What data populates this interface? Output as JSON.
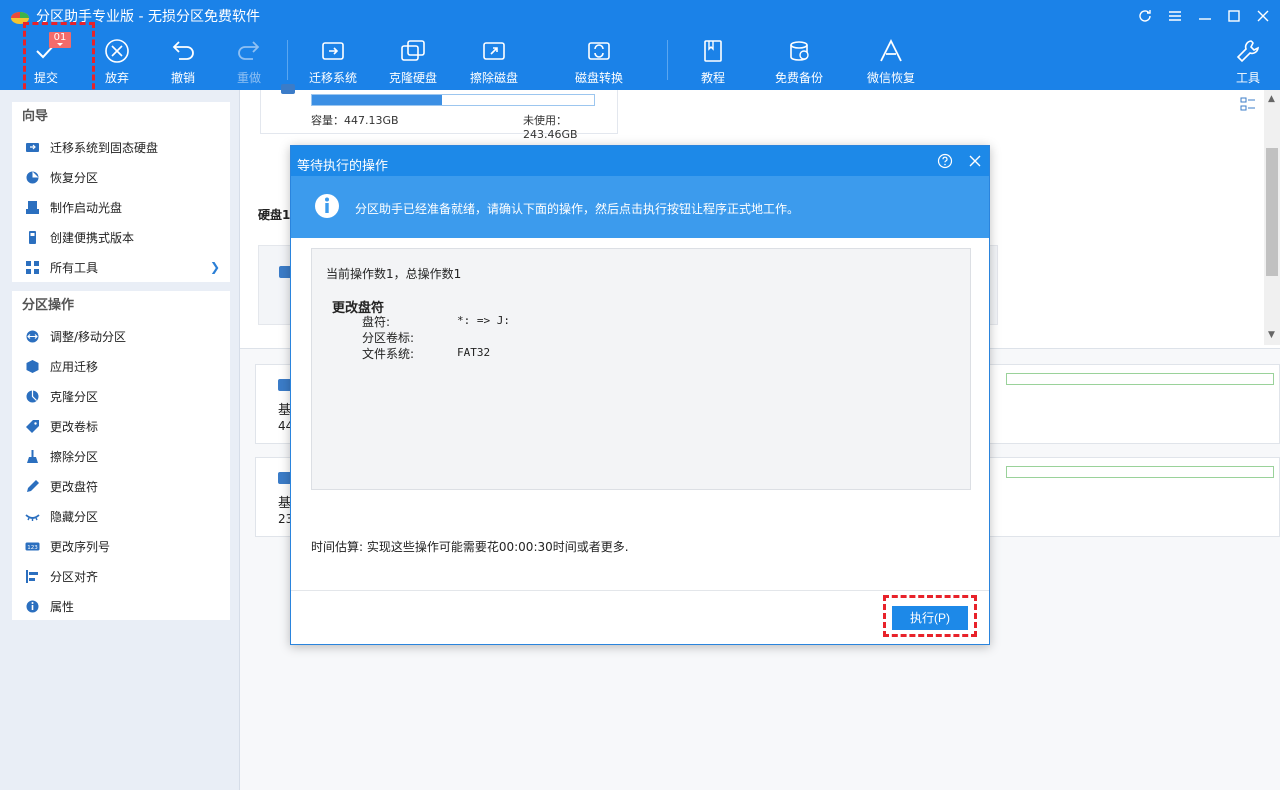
{
  "window": {
    "title": "分区助手专业版 - 无损分区免费软件"
  },
  "toolbar": {
    "commit_label": "提交",
    "commit_badge": "01",
    "discard_label": "放弃",
    "undo_label": "撤销",
    "redo_label": "重做",
    "migrate_os_label": "迁移系统",
    "clone_disk_label": "克隆硬盘",
    "wipe_disk_label": "擦除磁盘",
    "convert_disk_label": "磁盘转换",
    "tutorial_label": "教程",
    "free_backup_label": "免费备份",
    "wechat_recover_label": "微信恢复",
    "tools_label": "工具"
  },
  "sidebar": {
    "wizard": {
      "title": "向导",
      "items": [
        {
          "label": "迁移系统到固态硬盘",
          "icon": "migrate-icon"
        },
        {
          "label": "恢复分区",
          "icon": "recover-icon"
        },
        {
          "label": "制作启动光盘",
          "icon": "boot-disc-icon"
        },
        {
          "label": "创建便携式版本",
          "icon": "portable-icon"
        },
        {
          "label": "所有工具",
          "icon": "tools-grid-icon"
        }
      ]
    },
    "ops": {
      "title": "分区操作",
      "items": [
        {
          "label": "调整/移动分区",
          "icon": "resize-icon"
        },
        {
          "label": "应用迁移",
          "icon": "app-migrate-icon"
        },
        {
          "label": "克隆分区",
          "icon": "clone-icon"
        },
        {
          "label": "更改卷标",
          "icon": "tag-icon"
        },
        {
          "label": "擦除分区",
          "icon": "broom-icon"
        },
        {
          "label": "更改盘符",
          "icon": "pencil-icon"
        },
        {
          "label": "隐藏分区",
          "icon": "hide-icon"
        },
        {
          "label": "更改序列号",
          "icon": "serial-icon"
        },
        {
          "label": "分区对齐",
          "icon": "align-icon"
        },
        {
          "label": "属性",
          "icon": "info-icon"
        }
      ]
    }
  },
  "main": {
    "capacity": "容量：447.13GB",
    "unused": "未使用：243.46GB",
    "usage_fraction": 0.46,
    "disk_section": "硬盘1",
    "rows": [
      {
        "t1": "基",
        "t2": "44"
      },
      {
        "t1": "基",
        "t2": "23"
      }
    ]
  },
  "dialog": {
    "title": "等待执行的操作",
    "message": "分区助手已经准备就绪，请确认下面的操作，然后点击执行按钮让程序正式地工作。",
    "ops_count": "当前操作数1，总操作数1",
    "op_title": "更改盘符",
    "op_rows": [
      {
        "k": "盘符:",
        "v": "*: => J:"
      },
      {
        "k": "分区卷标:",
        "v": ""
      },
      {
        "k": "文件系统:",
        "v": "FAT32"
      }
    ],
    "time_estimate": "时间估算: 实现这些操作可能需要花00:00:30时间或者更多.",
    "execute_label": "执行(P)"
  },
  "colors": {
    "accent": "#1b82e8",
    "highlight": "#e8222a"
  }
}
